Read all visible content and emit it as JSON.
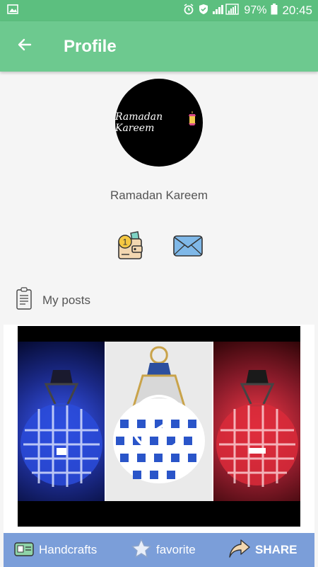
{
  "status_bar": {
    "battery": "97%",
    "time": "20:45"
  },
  "app_bar": {
    "title": "Profile"
  },
  "profile": {
    "avatar_text": "Ramadan Kareem",
    "name": "Ramadan Kareem",
    "wallet_badge": "1"
  },
  "posts_section": {
    "label": "My posts"
  },
  "post": {
    "category": "Handcrafts",
    "favorite": "favorite",
    "share": "SHARE"
  },
  "colors": {
    "status_bar": "#5cbf7f",
    "app_bar": "#6dc98f",
    "post_bar": "#7b9ed9"
  },
  "icons": [
    "image-icon",
    "alarm-icon",
    "shield-icon",
    "signal-icon",
    "battery-icon",
    "back-arrow-icon",
    "wallet-icon",
    "mail-icon",
    "clipboard-icon",
    "play-icon",
    "category-icon",
    "star-icon",
    "share-arrow-icon"
  ]
}
